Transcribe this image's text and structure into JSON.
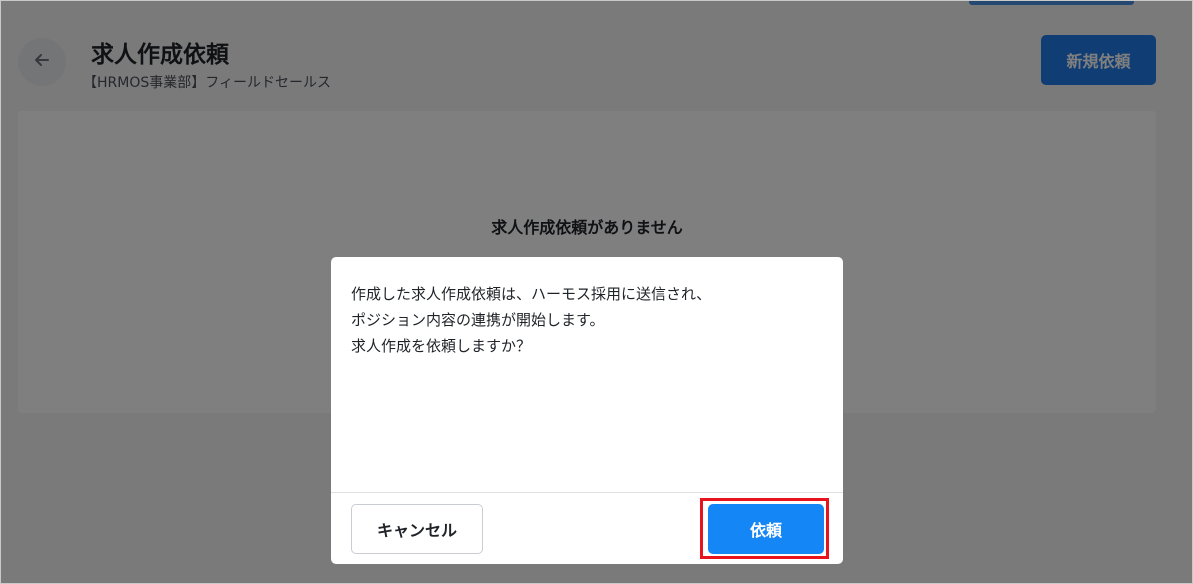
{
  "header": {
    "title": "求人作成依頼",
    "subtitle": "【HRMOS事業部】フィールドセールス",
    "back_icon": "arrow-left-icon",
    "new_request_label": "新規依頼"
  },
  "main": {
    "empty_message": "求人作成依頼がありません"
  },
  "dialog": {
    "message_lines": [
      "作成した求人作成依頼は、ハーモス採用に送信され、",
      "ポジション内容の連携が開始します。",
      "求人作成を依頼しますか？"
    ],
    "cancel_label": "キャンセル",
    "confirm_label": "依頼"
  },
  "colors": {
    "primary": "#1486f5",
    "highlight": "#e8141d",
    "overlay": "rgba(0,0,0,0.5)"
  }
}
